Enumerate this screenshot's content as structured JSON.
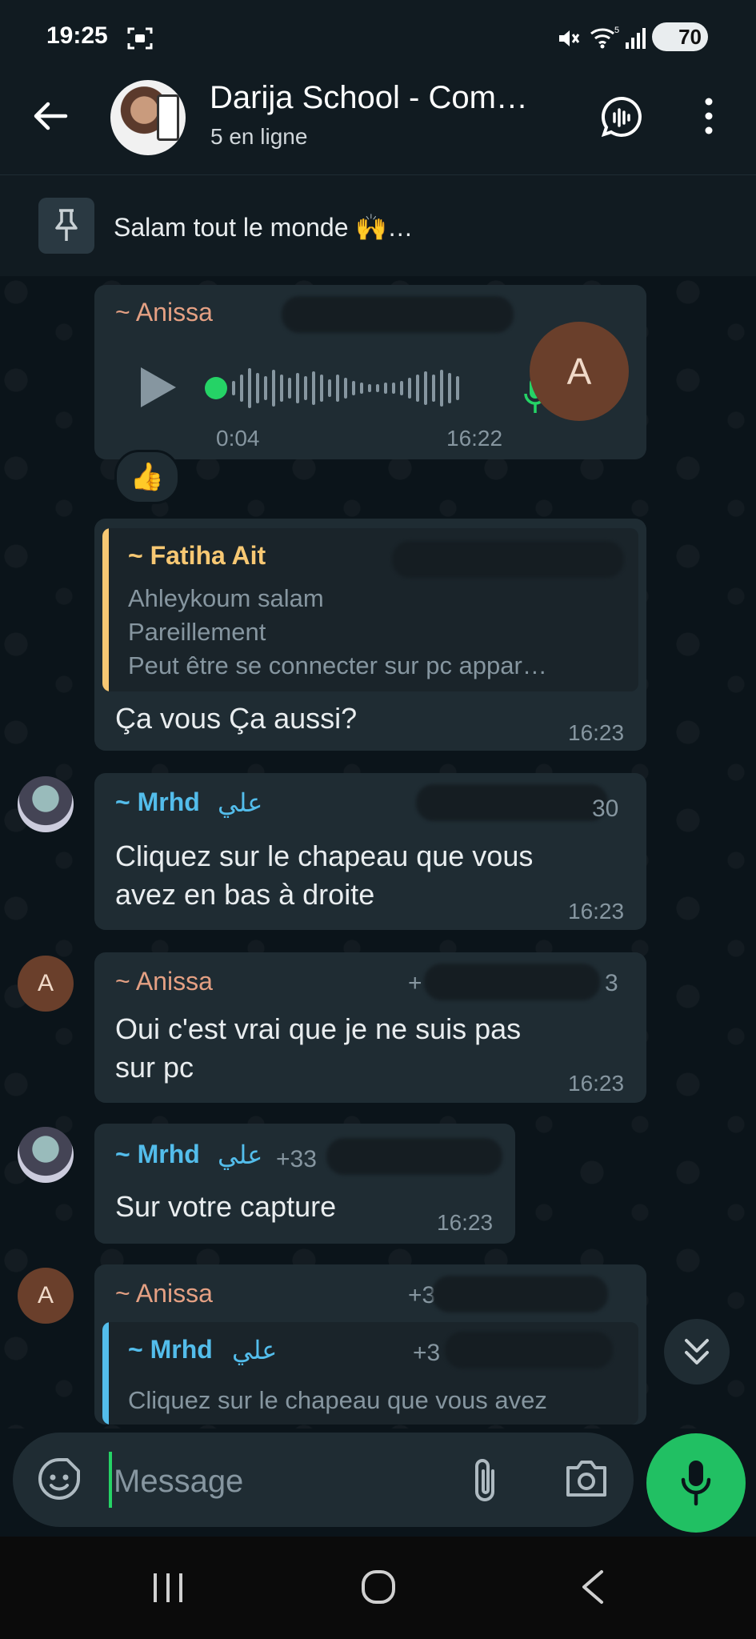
{
  "status": {
    "time": "19:25",
    "battery": "70"
  },
  "header": {
    "title": "Darija School - Com…",
    "subtitle": "5 en ligne",
    "back_icon": "arrow-left-icon",
    "call_icon": "voice-chat-icon",
    "menu_icon": "kebab-menu-icon"
  },
  "pinned": {
    "text": "Salam tout le monde 🙌…",
    "icon": "pin-icon"
  },
  "colors": {
    "accent": "#25d366",
    "bubble": "#1f2c33",
    "anissa": "#e4a083",
    "fatiha": "#f7c873",
    "mrhd": "#53bdeb"
  },
  "messages": [
    {
      "sender": "~ Anissa",
      "type": "voice",
      "duration": "0:04",
      "time": "16:22",
      "avatar_letter": "A",
      "reaction": "👍"
    },
    {
      "sender": "",
      "quote_sender": "~ Fatiha Ait",
      "quote_lines": [
        "Ahleykoum salam",
        "Pareillement",
        "Peut être se connecter sur pc appar…"
      ],
      "text": "Ça vous Ça aussi?",
      "time": "16:23"
    },
    {
      "sender": "~ Mrhd",
      "sender_extra": "علي",
      "phone_tail": "30",
      "text_lines": [
        "Cliquez sur le chapeau que vous",
        "avez en bas à droite"
      ],
      "time": "16:23"
    },
    {
      "sender": "~ Anissa",
      "avatar_letter": "A",
      "phone_head": "+",
      "phone_tail": "3",
      "text_lines": [
        "Oui c'est vrai que je ne suis pas",
        "sur pc"
      ],
      "time": "16:23"
    },
    {
      "sender": "~ Mrhd",
      "sender_extra": "علي",
      "phone": "+33",
      "text": "Sur votre capture",
      "time": "16:23"
    },
    {
      "sender": "~ Anissa",
      "avatar_letter": "A",
      "phone_head": "+3",
      "quote_sender": "~ Mrhd",
      "quote_sender_extra": "علي",
      "quote_phone": "+3",
      "quote_text": "Cliquez sur le chapeau que vous avez"
    }
  ],
  "composer": {
    "placeholder": "Message",
    "emoji_icon": "sticker-icon",
    "attach_icon": "paperclip-icon",
    "camera_icon": "camera-icon",
    "mic_icon": "microphone-icon"
  },
  "scroll_icon": "double-chevron-down-icon",
  "nav": {
    "recents_icon": "recents-icon",
    "home_icon": "home-icon",
    "back_icon": "back-chevron-icon"
  }
}
